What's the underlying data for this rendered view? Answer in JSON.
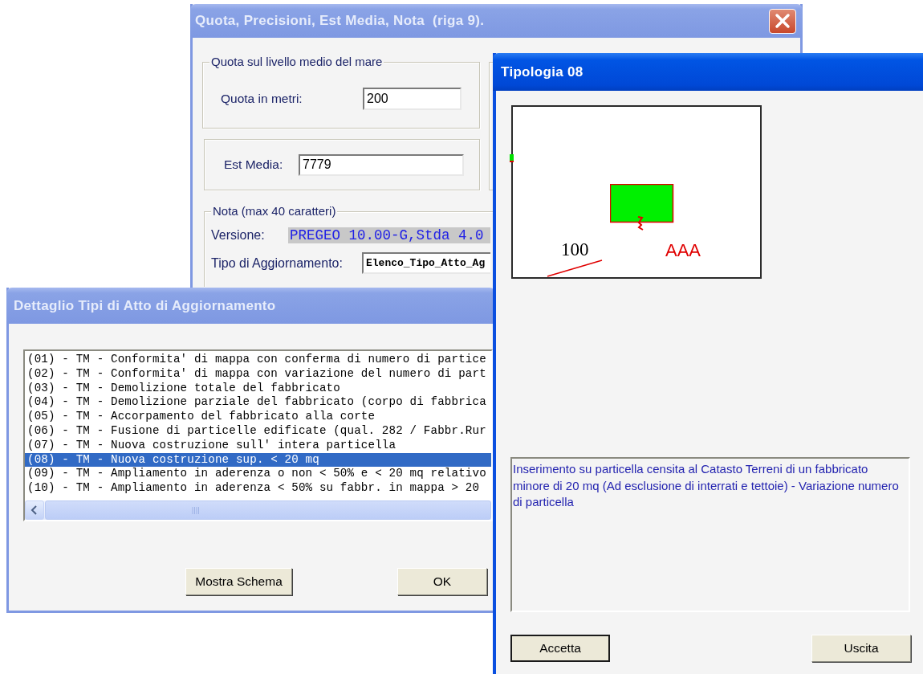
{
  "quota_dialog": {
    "title": "Quota, Precisioni, Est Media, Nota  (riga 9).",
    "active": false,
    "altitude_group": {
      "legend": "Quota sul livello medio del mare",
      "label": "Quota in metri:",
      "value": "200"
    },
    "est_media": {
      "label": "Est Media:",
      "value": "7779"
    },
    "nota_group": {
      "legend": "Nota (max 40 caratteri)",
      "versione_label": "Versione:",
      "versione_value": "PREGEO 10.00-G,Stda 4.0",
      "tipo_label": "Tipo di Aggiornamento:",
      "tipo_value": "Elenco_Tipo_Atto_Ag"
    }
  },
  "dettaglio_dialog": {
    "title": "Dettaglio Tipi di Atto di Aggiornamento",
    "active": false,
    "items": [
      {
        "label": "(01) - TM - Conformita' di mappa con conferma di numero di partice",
        "selected": false
      },
      {
        "label": "(02) - TM - Conformita' di mappa con variazione del numero di part",
        "selected": false
      },
      {
        "label": "(03) - TM - Demolizione totale del fabbricato",
        "selected": false
      },
      {
        "label": "(04) - TM - Demolizione parziale del fabbricato (corpo di fabbrica",
        "selected": false
      },
      {
        "label": "(05) - TM - Accorpamento del fabbricato alla corte",
        "selected": false
      },
      {
        "label": "(06) - TM - Fusione di particelle edificate (qual. 282 / Fabbr.Rur",
        "selected": false
      },
      {
        "label": "(07) - TM - Nuova costruzione sull' intera particella",
        "selected": false
      },
      {
        "label": "(08) - TM - Nuova costruzione sup. < 20 mq",
        "selected": true
      },
      {
        "label": "(09) - TM - Ampliamento in aderenza o non < 50% e < 20 mq relativo",
        "selected": false
      },
      {
        "label": "(10) - TM - Ampliamento in aderenza < 50% su fabbr. in mappa > 20",
        "selected": false
      }
    ],
    "buttons": [
      "Mostra Schema",
      "OK"
    ]
  },
  "tipologia_dialog": {
    "title": "Tipologia 08",
    "active": true,
    "schema": {
      "parcel_number": "100",
      "name": "AAA"
    },
    "description": "Inserimento su particella censita al Catasto Terreni di un fabbricato minore di 20 mq (Ad esclusione di interrati e tettoie) - Variazione numero di particella",
    "buttons": [
      {
        "label": "Accetta",
        "default": true
      },
      {
        "label": "Uscita",
        "default": false
      }
    ]
  }
}
